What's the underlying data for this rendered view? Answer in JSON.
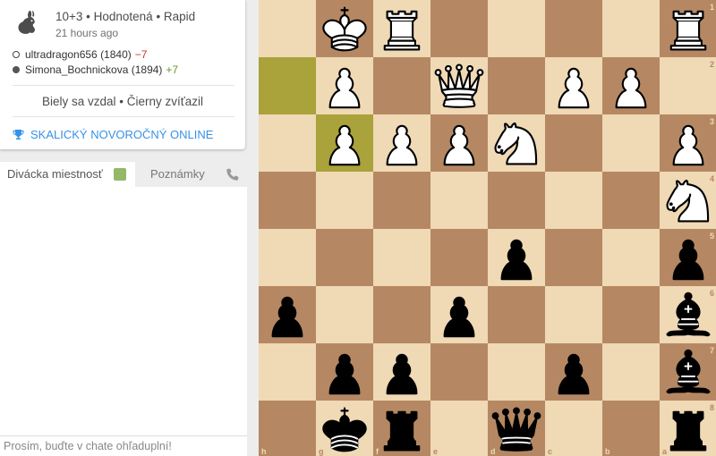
{
  "game": {
    "icon": "rabbit-icon",
    "title": "10+3 • Hodnotená • Rapid",
    "time_ago": "21 hours ago",
    "players": [
      {
        "color": "white",
        "name": "ultradragon656 (1840)",
        "diff": "−7",
        "diff_sign": "neg"
      },
      {
        "color": "black",
        "name": "Simona_Bochnickova (1894)",
        "diff": "+7",
        "diff_sign": "pos"
      }
    ],
    "result": "Biely sa vzdal • Čierny zvíťazil",
    "tournament": "SKALICKÝ NOVOROČNÝ ONLINE"
  },
  "tabs": {
    "chat": "Divácka miestnosť",
    "notes": "Poznámky"
  },
  "chat": {
    "placeholder": "Prosím, buďte v chate ohľaduplní!"
  },
  "colors": {
    "light": "#f0d9b5",
    "dark": "#b58863",
    "accent": "#3692e7",
    "toggle": "#93b868"
  },
  "board": {
    "orientation": "black",
    "files": [
      "h",
      "g",
      "f",
      "e",
      "d",
      "c",
      "b",
      "a"
    ],
    "ranks": [
      "1",
      "2",
      "3",
      "4",
      "5",
      "6",
      "7",
      "8"
    ],
    "highlight": [
      "h2",
      "g3"
    ],
    "pieces": [
      {
        "sq": "g1",
        "p": "wK"
      },
      {
        "sq": "f1",
        "p": "wR"
      },
      {
        "sq": "a1",
        "p": "wR"
      },
      {
        "sq": "g2",
        "p": "wP"
      },
      {
        "sq": "e2",
        "p": "wQ"
      },
      {
        "sq": "c2",
        "p": "wP"
      },
      {
        "sq": "b2",
        "p": "wP"
      },
      {
        "sq": "g3",
        "p": "wP"
      },
      {
        "sq": "f3",
        "p": "wP"
      },
      {
        "sq": "e3",
        "p": "wP"
      },
      {
        "sq": "d3",
        "p": "wN"
      },
      {
        "sq": "a3",
        "p": "wP"
      },
      {
        "sq": "a4",
        "p": "wN"
      },
      {
        "sq": "d5",
        "p": "bP"
      },
      {
        "sq": "a5",
        "p": "bP"
      },
      {
        "sq": "h6",
        "p": "bP"
      },
      {
        "sq": "e6",
        "p": "bP"
      },
      {
        "sq": "a6",
        "p": "bB"
      },
      {
        "sq": "g7",
        "p": "bP"
      },
      {
        "sq": "f7",
        "p": "bP"
      },
      {
        "sq": "c7",
        "p": "bP"
      },
      {
        "sq": "a7",
        "p": "bB"
      },
      {
        "sq": "g8",
        "p": "bK"
      },
      {
        "sq": "f8",
        "p": "bR"
      },
      {
        "sq": "d8",
        "p": "bQ"
      },
      {
        "sq": "a8",
        "p": "bR"
      }
    ]
  }
}
